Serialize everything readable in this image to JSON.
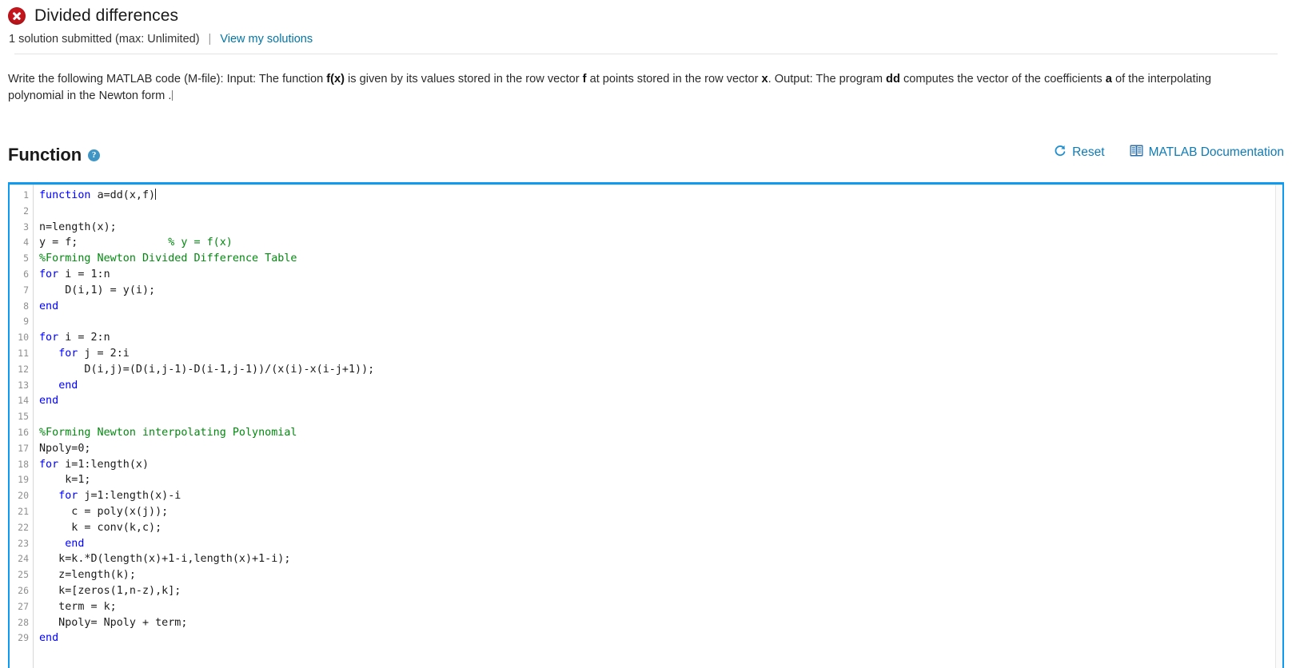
{
  "problem": {
    "status_icon": "error-circle-x-icon",
    "title": "Divided differences",
    "submitted_text": "1 solution submitted (max: Unlimited)",
    "separator": "|",
    "view_solutions_label": "View my solutions"
  },
  "description": {
    "part1": "Write the following MATLAB code (M-file): Input: The function ",
    "bold1": "f(x)",
    "part2": " is given by its values stored in the row vector ",
    "bold2": "f",
    "part3": " at points stored in the row vector ",
    "bold3": "x",
    "part4": ". Output: The program ",
    "bold4": "dd",
    "part5": " computes the vector of the coefficients ",
    "bold5": "a",
    "part6": " of the interpolating polynomial in the Newton form ."
  },
  "function_section": {
    "heading": "Function",
    "help_icon": "question-mark-icon",
    "help_glyph": "?",
    "reset_label": "Reset",
    "reset_icon": "refresh-circular-arrow-icon",
    "docs_label": "MATLAB Documentation",
    "docs_icon": "book-icon"
  },
  "colors": {
    "accent_blue": "#0f7bb5",
    "editor_border": "#0c9bf0",
    "error_red": "#c4161c",
    "keyword_blue": "#0000ff",
    "comment_green": "#028a0f",
    "help_icon_blue": "#3f96c4"
  },
  "editor": {
    "line_numbers": [
      1,
      2,
      3,
      4,
      5,
      6,
      7,
      8,
      9,
      10,
      11,
      12,
      13,
      14,
      15,
      16,
      17,
      18,
      19,
      20,
      21,
      22,
      23,
      24,
      25,
      26,
      27,
      28,
      29
    ],
    "lines": [
      {
        "n": 1,
        "segments": [
          {
            "t": "function ",
            "c": "kw"
          },
          {
            "t": "a=dd(x,f)",
            "c": ""
          }
        ],
        "cursor": true
      },
      {
        "n": 2,
        "segments": []
      },
      {
        "n": 3,
        "segments": [
          {
            "t": "n=length(x);",
            "c": ""
          }
        ]
      },
      {
        "n": 4,
        "segments": [
          {
            "t": "y = f;              ",
            "c": ""
          },
          {
            "t": "% y = f(x)",
            "c": "cm"
          }
        ]
      },
      {
        "n": 5,
        "segments": [
          {
            "t": "%Forming Newton Divided Difference Table",
            "c": "cm"
          }
        ]
      },
      {
        "n": 6,
        "segments": [
          {
            "t": "for",
            "c": "kw"
          },
          {
            "t": " i = 1:n",
            "c": ""
          }
        ]
      },
      {
        "n": 7,
        "segments": [
          {
            "t": "    D(i,1) = y(i);",
            "c": ""
          }
        ]
      },
      {
        "n": 8,
        "segments": [
          {
            "t": "end",
            "c": "kw"
          }
        ]
      },
      {
        "n": 9,
        "segments": []
      },
      {
        "n": 10,
        "segments": [
          {
            "t": "for",
            "c": "kw"
          },
          {
            "t": " i = 2:n",
            "c": ""
          }
        ]
      },
      {
        "n": 11,
        "segments": [
          {
            "t": "   ",
            "c": ""
          },
          {
            "t": "for",
            "c": "kw"
          },
          {
            "t": " j = 2:i",
            "c": ""
          }
        ]
      },
      {
        "n": 12,
        "segments": [
          {
            "t": "       D(i,j)=(D(i,j-1)-D(i-1,j-1))/(x(i)-x(i-j+1));",
            "c": ""
          }
        ]
      },
      {
        "n": 13,
        "segments": [
          {
            "t": "   ",
            "c": ""
          },
          {
            "t": "end",
            "c": "kw"
          }
        ]
      },
      {
        "n": 14,
        "segments": [
          {
            "t": "end",
            "c": "kw"
          }
        ]
      },
      {
        "n": 15,
        "segments": []
      },
      {
        "n": 16,
        "segments": [
          {
            "t": "%Forming Newton interpolating Polynomial",
            "c": "cm"
          }
        ]
      },
      {
        "n": 17,
        "segments": [
          {
            "t": "Npoly=0;",
            "c": ""
          }
        ]
      },
      {
        "n": 18,
        "segments": [
          {
            "t": "for",
            "c": "kw"
          },
          {
            "t": " i=1:length(x)",
            "c": ""
          }
        ]
      },
      {
        "n": 19,
        "segments": [
          {
            "t": "    k=1;",
            "c": ""
          }
        ]
      },
      {
        "n": 20,
        "segments": [
          {
            "t": "   ",
            "c": ""
          },
          {
            "t": "for",
            "c": "kw"
          },
          {
            "t": " j=1:length(x)-i",
            "c": ""
          }
        ]
      },
      {
        "n": 21,
        "segments": [
          {
            "t": "     c = poly(x(j));",
            "c": ""
          }
        ]
      },
      {
        "n": 22,
        "segments": [
          {
            "t": "     k = conv(k,c);",
            "c": ""
          }
        ]
      },
      {
        "n": 23,
        "segments": [
          {
            "t": "    ",
            "c": ""
          },
          {
            "t": "end",
            "c": "kw"
          }
        ]
      },
      {
        "n": 24,
        "segments": [
          {
            "t": "   k=k.*D(length(x)+1-i,length(x)+1-i);",
            "c": ""
          }
        ]
      },
      {
        "n": 25,
        "segments": [
          {
            "t": "   z=length(k);",
            "c": ""
          }
        ]
      },
      {
        "n": 26,
        "segments": [
          {
            "t": "   k=[zeros(1,n-z),k];",
            "c": ""
          }
        ]
      },
      {
        "n": 27,
        "segments": [
          {
            "t": "   term = k;",
            "c": ""
          }
        ]
      },
      {
        "n": 28,
        "segments": [
          {
            "t": "   Npoly= Npoly + term;",
            "c": ""
          }
        ]
      },
      {
        "n": 29,
        "segments": [
          {
            "t": "end",
            "c": "kw"
          }
        ]
      }
    ]
  }
}
